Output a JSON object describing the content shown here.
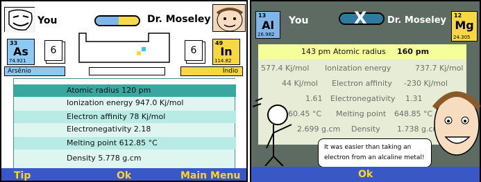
{
  "left": {
    "you_label": "You",
    "opponent_label": "Dr. Moseley",
    "you_card_count": "6",
    "opp_card_count": "6",
    "you_element": {
      "number": "33",
      "symbol": "As",
      "mass": "74.921",
      "name": "Arsênio"
    },
    "opp_element": {
      "number": "49",
      "symbol": "In",
      "mass": "114.82",
      "name": "Índio"
    },
    "stats": [
      "Atomic radius 120 pm",
      "Ionization energy    947.0 Kj/mol",
      "Electron affinity 78 Kj/mol",
      "Electronegativity    2.18",
      "Melting point    612.85 °C",
      "Density    5.778 g.cm"
    ],
    "softkeys": {
      "left": "Tip",
      "center": "Ok",
      "right": "Main Menu"
    }
  },
  "right": {
    "you_label": "You",
    "vs_label": "X",
    "opponent_label": "Dr. Moseley",
    "you_element": {
      "number": "13",
      "symbol": "Al",
      "mass": "26.982"
    },
    "opp_element": {
      "number": "12",
      "symbol": "Mg",
      "mass": "24.305"
    },
    "rows": [
      {
        "left": "143 pm",
        "label": "Atomic radius",
        "right": "160 pm"
      },
      {
        "left": "577.4 Kj/mol",
        "label": "Ionization energy",
        "right": "737.7 Kj/mol"
      },
      {
        "left": "44 Kj/mol",
        "label": "Electron affinity",
        "right": "-230 Kj/mol"
      },
      {
        "left": "1.61",
        "label": "Electronegativity",
        "right": "1.31"
      },
      {
        "left": "660.45 °C",
        "label": "Melting point",
        "right": "648.85 °C"
      },
      {
        "left": "2.699 g.cm",
        "label": "Density",
        "right": "1.738 g.cm"
      }
    ],
    "speech": "It was easier than taking an electron from an alcaline metal!",
    "softkeys": {
      "center": "Ok"
    }
  },
  "colors": {
    "softkey_bg": "#3a57c6",
    "softkey_text": "#ffd52a",
    "highlight_yellow": "#f4ff9b",
    "teal": "#3aa6a0"
  }
}
